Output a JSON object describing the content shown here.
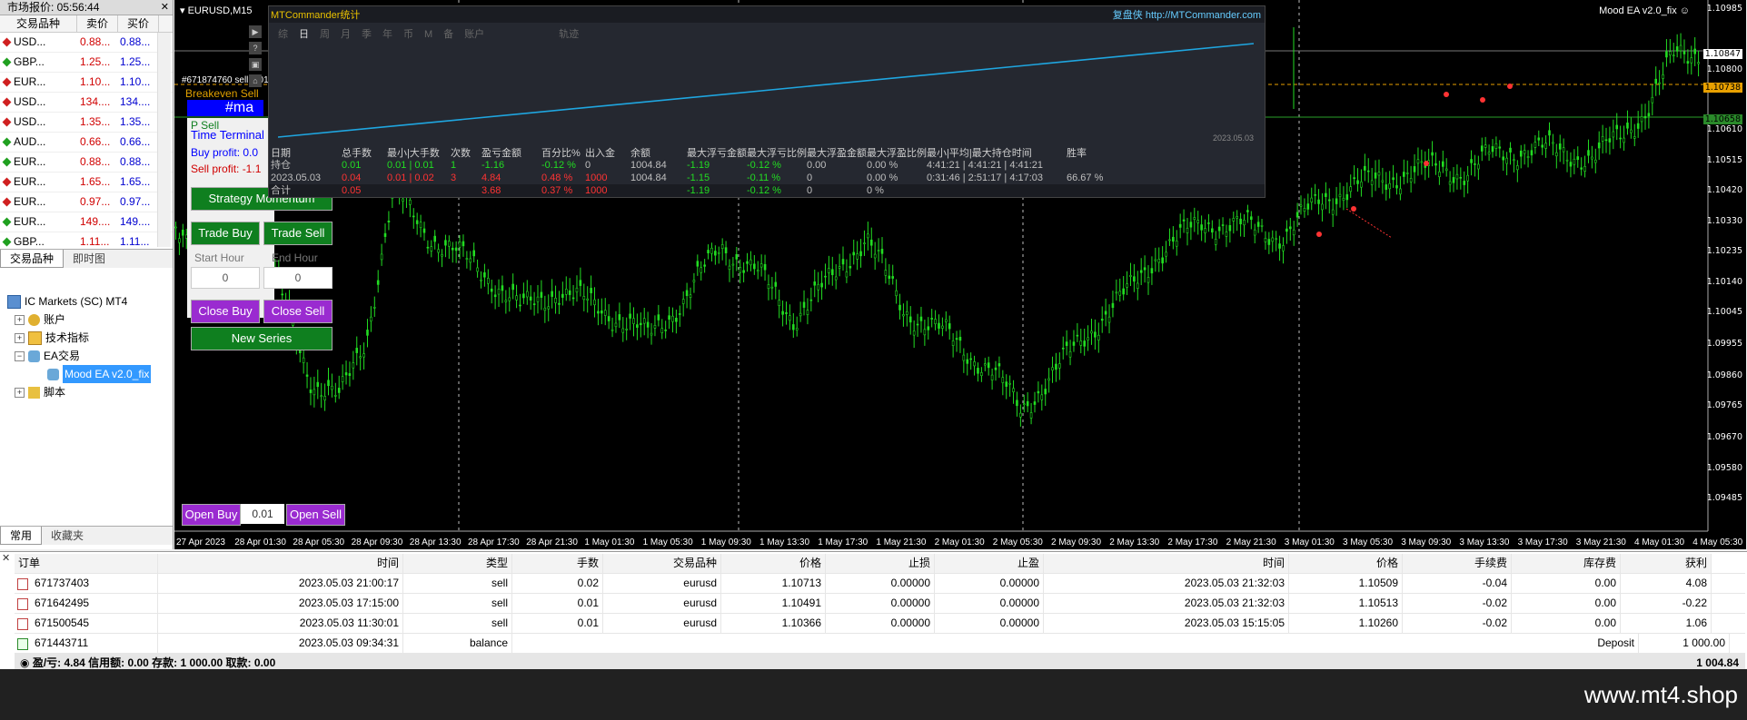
{
  "market_watch": {
    "title": "市场报价: 05:56:44",
    "headers": [
      "交易品种",
      "卖价",
      "买价"
    ],
    "rows": [
      {
        "symbol": "USD...",
        "bid": "0.88...",
        "ask": "0.88...",
        "color": "#d02020"
      },
      {
        "symbol": "GBP...",
        "bid": "1.25...",
        "ask": "1.25...",
        "color": "#20a020"
      },
      {
        "symbol": "EUR...",
        "bid": "1.10...",
        "ask": "1.10...",
        "color": "#d02020"
      },
      {
        "symbol": "USD...",
        "bid": "134....",
        "ask": "134....",
        "color": "#d02020"
      },
      {
        "symbol": "USD...",
        "bid": "1.35...",
        "ask": "1.35...",
        "color": "#d02020"
      },
      {
        "symbol": "AUD...",
        "bid": "0.66...",
        "ask": "0.66...",
        "color": "#20a020"
      },
      {
        "symbol": "EUR...",
        "bid": "0.88...",
        "ask": "0.88...",
        "color": "#20a020"
      },
      {
        "symbol": "EUR...",
        "bid": "1.65...",
        "ask": "1.65...",
        "color": "#d02020"
      },
      {
        "symbol": "EUR...",
        "bid": "0.97...",
        "ask": "0.97...",
        "color": "#d02020"
      },
      {
        "symbol": "EUR...",
        "bid": "149....",
        "ask": "149....",
        "color": "#20a020"
      },
      {
        "symbol": "GBP...",
        "bid": "1.11...",
        "ask": "1.11...",
        "color": "#20a020"
      }
    ],
    "tabs": [
      "交易品种",
      "即时图"
    ]
  },
  "navigator": {
    "title": "导航",
    "root": "IC Markets (SC) MT4",
    "items": [
      "账户",
      "技术指标",
      "EA交易",
      "Mood EA v2.0_fix",
      "脚本"
    ],
    "tabs": [
      "常用",
      "收藏夹"
    ]
  },
  "chart": {
    "symbol": "EURUSD,M15",
    "ea_name": "Mood EA v2.0_fix",
    "smiley": "☺",
    "order_label": "#671874760 sell 0.01",
    "prices": [
      "1.10985",
      "1.10847",
      "1.10800",
      "1.10738",
      "1.10658",
      "1.10610",
      "1.10515",
      "1.10420",
      "1.10330",
      "1.10235",
      "1.10140",
      "1.10045",
      "1.09955",
      "1.09860",
      "1.09765",
      "1.09670",
      "1.09580",
      "1.09485"
    ],
    "times": [
      "27 Apr 2023",
      "28 Apr 01:30",
      "28 Apr 05:30",
      "28 Apr 09:30",
      "28 Apr 13:30",
      "28 Apr 17:30",
      "28 Apr 21:30",
      "1 May 01:30",
      "1 May 05:30",
      "1 May 09:30",
      "1 May 13:30",
      "1 May 17:30",
      "1 May 21:30",
      "2 May 01:30",
      "2 May 05:30",
      "2 May 09:30",
      "2 May 13:30",
      "2 May 17:30",
      "2 May 21:30",
      "3 May 01:30",
      "3 May 05:30",
      "3 May 09:30",
      "3 May 13:30",
      "3 May 17:30",
      "3 May 21:30",
      "4 May 01:30",
      "4 May 05:30"
    ],
    "left_icons": [
      "▶",
      "?",
      "▣",
      "⌂"
    ]
  },
  "ea_panel": {
    "breakeven": "Breakeven Sell",
    "magic": "#ma",
    "status": "P Sell",
    "time_terminal": "Time Terminal",
    "buy_profit": "Buy profit: 0.0",
    "sell_profit": "Sell profit: -1.1",
    "strategy": "Strategy Momentum",
    "trade_buy": "Trade Buy",
    "trade_sell": "Trade Sell",
    "start_hour_label": "Start Hour",
    "end_hour_label": "End Hour",
    "start_hour": "0",
    "end_hour": "0",
    "close_buy": "Close Buy",
    "close_sell": "Close Sell",
    "new_series": "New Series",
    "open_buy": "Open Buy",
    "lot": "0.01",
    "open_sell": "Open Sell"
  },
  "stats": {
    "title": "MTCommander统计",
    "site": "复盘侠 http://MTCommander.com",
    "periods": [
      "综",
      "日",
      "周",
      "月",
      "季",
      "年",
      "币",
      "M",
      "备",
      "账户",
      "轨迹"
    ],
    "date_label": "2023.05.03",
    "headers": [
      "日期",
      "总手数",
      "最小|大手数",
      "次数",
      "盈亏金额",
      "百分比%",
      "出入金",
      "余额",
      "最大浮亏金额",
      "最大浮亏比例",
      "最大浮盈金额",
      "最大浮盈比例",
      "最小|平均|最大持仓时间",
      "胜率"
    ],
    "rows": [
      [
        "持仓",
        "0.01",
        "0.01 | 0.01",
        "1",
        "-1.16",
        "-0.12 %",
        "0",
        "1004.84",
        "-1.19",
        "-0.12 %",
        "0.00",
        "0.00 %",
        "4:41:21 | 4:41:21 | 4:41:21",
        ""
      ],
      [
        "2023.05.03",
        "0.04",
        "0.01 | 0.02",
        "3",
        "4.84",
        "0.48 %",
        "1000",
        "1004.84",
        "-1.15",
        "-0.11 %",
        "0",
        "0.00 %",
        "0:31:46 | 2:51:17 | 4:17:03",
        "66.67 %"
      ],
      [
        "合计",
        "0.05",
        "",
        "",
        "3.68",
        "0.37 %",
        "1000",
        "",
        "-1.19",
        "-0.12 %",
        "0",
        "0 %",
        "",
        ""
      ]
    ]
  },
  "terminal": {
    "headers": [
      "订单",
      "时间",
      "类型",
      "手数",
      "交易品种",
      "价格",
      "止损",
      "止盈",
      "时间",
      "价格",
      "手续费",
      "库存费",
      "获利"
    ],
    "rows": [
      [
        "671737403",
        "2023.05.03 21:00:17",
        "sell",
        "0.02",
        "eurusd",
        "1.10713",
        "0.00000",
        "0.00000",
        "2023.05.03 21:32:03",
        "1.10509",
        "-0.04",
        "0.00",
        "4.08"
      ],
      [
        "671642495",
        "2023.05.03 17:15:00",
        "sell",
        "0.01",
        "eurusd",
        "1.10491",
        "0.00000",
        "0.00000",
        "2023.05.03 21:32:03",
        "1.10513",
        "-0.02",
        "0.00",
        "-0.22"
      ],
      [
        "671500545",
        "2023.05.03 11:30:01",
        "sell",
        "0.01",
        "eurusd",
        "1.10366",
        "0.00000",
        "0.00000",
        "2023.05.03 15:15:05",
        "1.10260",
        "-0.02",
        "0.00",
        "1.06"
      ]
    ],
    "balance_row": {
      "order": "671443711",
      "time": "2023.05.03 09:34:31",
      "type": "balance",
      "comment": "Deposit",
      "profit": "1 000.00"
    },
    "summary": "盈/亏: 4.84  信用额: 0.00  存款: 1 000.00  取款: 0.00",
    "total": "1 004.84"
  },
  "watermark": "www.mt4.shop"
}
